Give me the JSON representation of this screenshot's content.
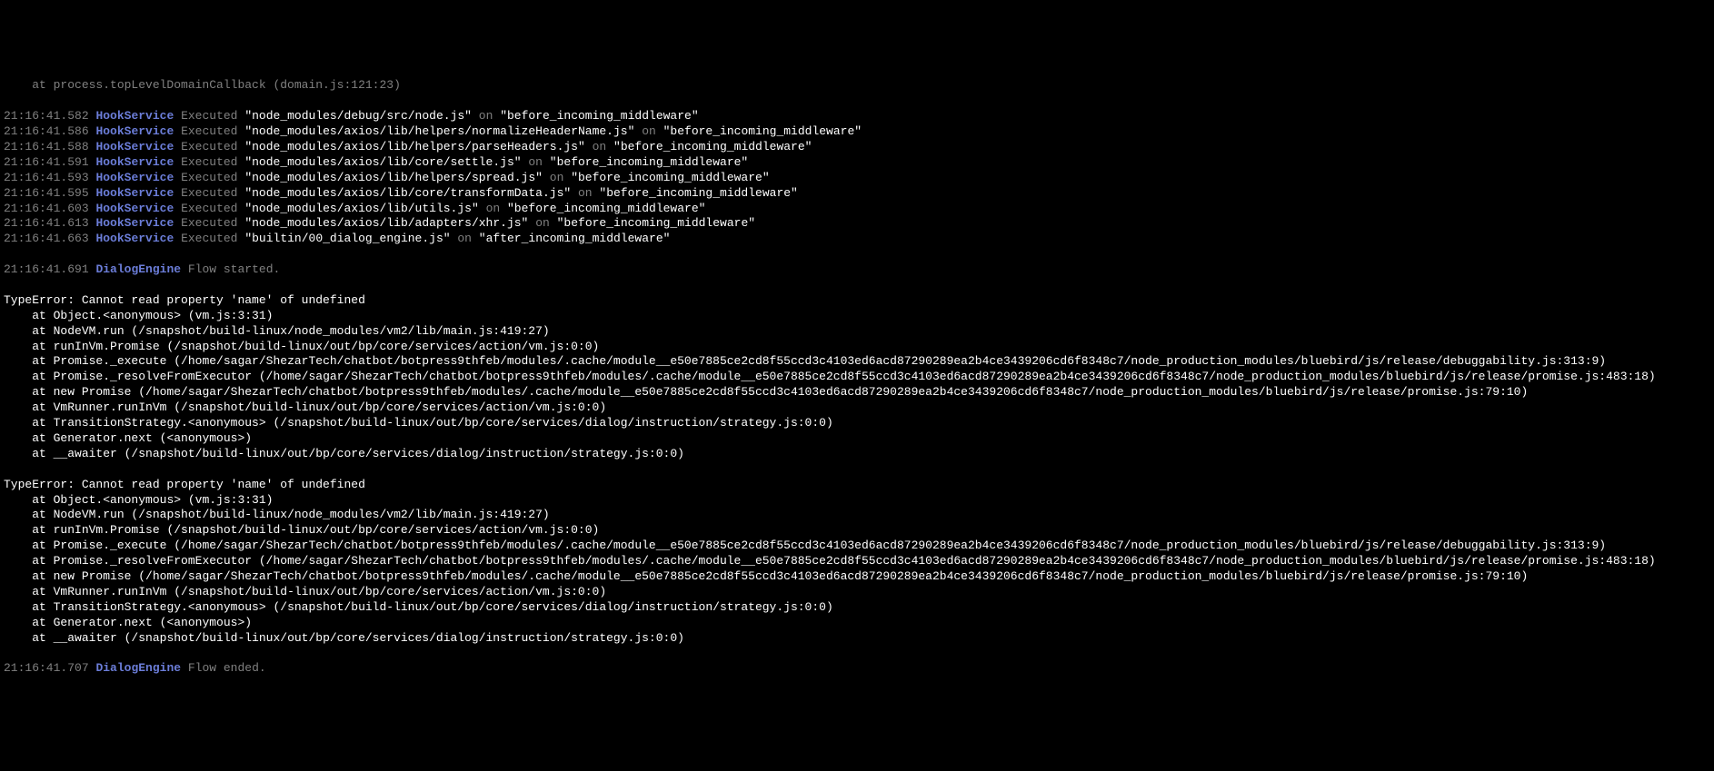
{
  "top_fragment": "    at process.topLevelDomainCallback (domain.js:121:23)",
  "hook_logs": [
    {
      "ts": "21:16:41.582",
      "service": "HookService",
      "path": "\"node_modules/debug/src/node.js\"",
      "hook": "\"before_incoming_middleware\""
    },
    {
      "ts": "21:16:41.586",
      "service": "HookService",
      "path": "\"node_modules/axios/lib/helpers/normalizeHeaderName.js\"",
      "hook": "\"before_incoming_middleware\""
    },
    {
      "ts": "21:16:41.588",
      "service": "HookService",
      "path": "\"node_modules/axios/lib/helpers/parseHeaders.js\"",
      "hook": "\"before_incoming_middleware\""
    },
    {
      "ts": "21:16:41.591",
      "service": "HookService",
      "path": "\"node_modules/axios/lib/core/settle.js\"",
      "hook": "\"before_incoming_middleware\""
    },
    {
      "ts": "21:16:41.593",
      "service": "HookService",
      "path": "\"node_modules/axios/lib/helpers/spread.js\"",
      "hook": "\"before_incoming_middleware\""
    },
    {
      "ts": "21:16:41.595",
      "service": "HookService",
      "path": "\"node_modules/axios/lib/core/transformData.js\"",
      "hook": "\"before_incoming_middleware\""
    },
    {
      "ts": "21:16:41.603",
      "service": "HookService",
      "path": "\"node_modules/axios/lib/utils.js\"",
      "hook": "\"before_incoming_middleware\""
    },
    {
      "ts": "21:16:41.613",
      "service": "HookService",
      "path": "\"node_modules/axios/lib/adapters/xhr.js\"",
      "hook": "\"before_incoming_middleware\""
    },
    {
      "ts": "21:16:41.663",
      "service": "HookService",
      "path": "\"builtin/00_dialog_engine.js\"",
      "hook": "\"after_incoming_middleware\""
    }
  ],
  "flow_start": {
    "ts": "21:16:41.691",
    "service": "DialogEngine",
    "text": "Flow started."
  },
  "error1": [
    "TypeError: Cannot read property 'name' of undefined",
    "    at Object.<anonymous> (vm.js:3:31)",
    "    at NodeVM.run (/snapshot/build-linux/node_modules/vm2/lib/main.js:419:27)",
    "    at runInVm.Promise (/snapshot/build-linux/out/bp/core/services/action/vm.js:0:0)",
    "    at Promise._execute (/home/sagar/ShezarTech/chatbot/botpress9thfeb/modules/.cache/module__e50e7885ce2cd8f55ccd3c4103ed6acd87290289ea2b4ce3439206cd6f8348c7/node_production_modules/bluebird/js/release/debuggability.js:313:9)",
    "    at Promise._resolveFromExecutor (/home/sagar/ShezarTech/chatbot/botpress9thfeb/modules/.cache/module__e50e7885ce2cd8f55ccd3c4103ed6acd87290289ea2b4ce3439206cd6f8348c7/node_production_modules/bluebird/js/release/promise.js:483:18)",
    "    at new Promise (/home/sagar/ShezarTech/chatbot/botpress9thfeb/modules/.cache/module__e50e7885ce2cd8f55ccd3c4103ed6acd87290289ea2b4ce3439206cd6f8348c7/node_production_modules/bluebird/js/release/promise.js:79:10)",
    "    at VmRunner.runInVm (/snapshot/build-linux/out/bp/core/services/action/vm.js:0:0)",
    "    at TransitionStrategy.<anonymous> (/snapshot/build-linux/out/bp/core/services/dialog/instruction/strategy.js:0:0)",
    "    at Generator.next (<anonymous>)",
    "    at __awaiter (/snapshot/build-linux/out/bp/core/services/dialog/instruction/strategy.js:0:0)"
  ],
  "error2": [
    "TypeError: Cannot read property 'name' of undefined",
    "    at Object.<anonymous> (vm.js:3:31)",
    "    at NodeVM.run (/snapshot/build-linux/node_modules/vm2/lib/main.js:419:27)",
    "    at runInVm.Promise (/snapshot/build-linux/out/bp/core/services/action/vm.js:0:0)",
    "    at Promise._execute (/home/sagar/ShezarTech/chatbot/botpress9thfeb/modules/.cache/module__e50e7885ce2cd8f55ccd3c4103ed6acd87290289ea2b4ce3439206cd6f8348c7/node_production_modules/bluebird/js/release/debuggability.js:313:9)",
    "    at Promise._resolveFromExecutor (/home/sagar/ShezarTech/chatbot/botpress9thfeb/modules/.cache/module__e50e7885ce2cd8f55ccd3c4103ed6acd87290289ea2b4ce3439206cd6f8348c7/node_production_modules/bluebird/js/release/promise.js:483:18)",
    "    at new Promise (/home/sagar/ShezarTech/chatbot/botpress9thfeb/modules/.cache/module__e50e7885ce2cd8f55ccd3c4103ed6acd87290289ea2b4ce3439206cd6f8348c7/node_production_modules/bluebird/js/release/promise.js:79:10)",
    "    at VmRunner.runInVm (/snapshot/build-linux/out/bp/core/services/action/vm.js:0:0)",
    "    at TransitionStrategy.<anonymous> (/snapshot/build-linux/out/bp/core/services/dialog/instruction/strategy.js:0:0)",
    "    at Generator.next (<anonymous>)",
    "    at __awaiter (/snapshot/build-linux/out/bp/core/services/dialog/instruction/strategy.js:0:0)"
  ],
  "flow_end": {
    "ts": "21:16:41.707",
    "service": "DialogEngine",
    "text": "Flow ended."
  },
  "executed_label": "Executed",
  "on_label": "on"
}
